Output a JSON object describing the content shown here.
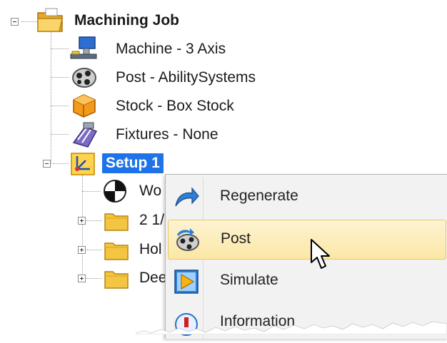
{
  "tree": {
    "root": {
      "label": "Machining Job",
      "icon": "folder-open-icon"
    },
    "children": [
      {
        "label": "Machine - 3 Axis",
        "icon": "machine-icon"
      },
      {
        "label": "Post - AbilitySystems",
        "icon": "post-reel-icon"
      },
      {
        "label": "Stock - Box Stock",
        "icon": "stock-box-icon"
      },
      {
        "label": "Fixtures - None",
        "icon": "fixtures-icon"
      }
    ],
    "setup": {
      "label": "Setup 1",
      "icon": "setup-icon",
      "children": [
        {
          "label": "Wo",
          "icon": "work-offset-icon"
        },
        {
          "label": "2 1/",
          "icon": "folder-icon"
        },
        {
          "label": "Hol",
          "icon": "folder-icon"
        },
        {
          "label": "Dee",
          "icon": "folder-icon"
        }
      ]
    }
  },
  "context_menu": {
    "items": [
      {
        "label": "Regenerate",
        "icon": "regenerate-arrow-icon"
      },
      {
        "label": "Post",
        "icon": "post-icon",
        "highlighted": true
      },
      {
        "label": "Simulate",
        "icon": "simulate-play-icon"
      },
      {
        "label": "Information",
        "icon": "information-icon"
      }
    ]
  },
  "colors": {
    "selection": "#1e73e8",
    "menu_background": "#f2f2f2",
    "menu_highlight": "#fbe7a6",
    "folder": "#f4c542"
  }
}
